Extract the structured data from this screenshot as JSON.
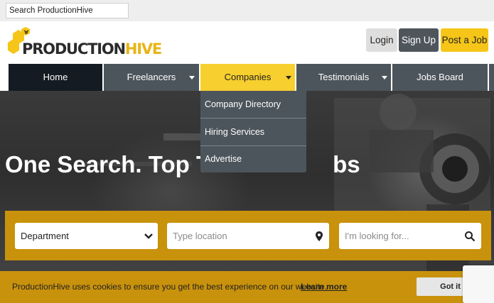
{
  "top_search": {
    "value": "Search ProductionHive"
  },
  "logo": {
    "part1": "PRODUCTION",
    "part2": "HIVE"
  },
  "header_buttons": {
    "login": "Login",
    "signup": "Sign Up",
    "post": "Post a Job"
  },
  "nav": {
    "home": "Home",
    "freelancers": "Freelancers",
    "companies": "Companies",
    "testimonials": "Testimonials",
    "jobs_board": "Jobs Board"
  },
  "companies_menu": {
    "items": [
      "Company Directory",
      "Hiring Services",
      "Advertise"
    ]
  },
  "hero": {
    "title_left": "One Search. Top TV",
    "title_right": "bs"
  },
  "search": {
    "department": "Department",
    "location_placeholder": "Type location",
    "looking_placeholder": "I'm looking for..."
  },
  "cookie": {
    "text": "ProductionHive uses cookies to ensure you get the best experience on our website.",
    "link": "Learn more",
    "button": "Got it"
  },
  "colors": {
    "brand_yellow": "#f5c518",
    "nav_dark": "#4c555c",
    "nav_active": "#141b22",
    "panel_gold": "#c9920c"
  },
  "icons": {
    "caret": "chevron-down-icon",
    "location": "map-pin-icon",
    "search": "search-icon",
    "logo": "bee-hexagon-icon"
  }
}
